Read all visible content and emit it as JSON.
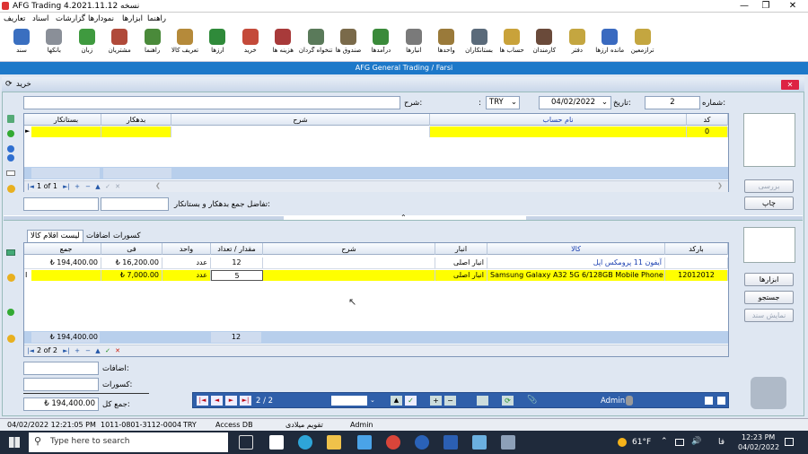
{
  "title_bar": {
    "title": "AFG Trading 4.2021.11.12 نسخه"
  },
  "menu": [
    "تعاریف",
    "اسناد",
    "گزارشات",
    "نمودارها",
    "ابزارها",
    "راهنما"
  ],
  "toolbar": [
    {
      "label": "سند",
      "icon": "document-icon",
      "color": "#3a6fc0"
    },
    {
      "label": "بانکها",
      "icon": "bank-icon",
      "color": "#8a8f98"
    },
    {
      "label": "زبان",
      "icon": "language-icon",
      "color": "#3f9a3f"
    },
    {
      "label": "مشتریان",
      "icon": "customers-icon",
      "color": "#b04a3a"
    },
    {
      "label": "راهنما",
      "icon": "help-icon",
      "color": "#4a8a3a"
    },
    {
      "label": "تعریف کالا",
      "icon": "product-icon",
      "color": "#b58a3a"
    },
    {
      "label": "ارزها",
      "icon": "currency-icon",
      "color": "#2f8a3a"
    },
    {
      "label": "خرید",
      "icon": "purchase-icon",
      "color": "#c44a3a"
    },
    {
      "label": "هزینه ها",
      "icon": "expenses-icon",
      "color": "#a83a3a"
    },
    {
      "label": "تنخواه گردان",
      "icon": "petty-cash-icon",
      "color": "#5a7a5a"
    },
    {
      "label": "صندوق ها",
      "icon": "cash-box-icon",
      "color": "#7a6a4a"
    },
    {
      "label": "درآمدها",
      "icon": "income-icon",
      "color": "#3a8a3a"
    },
    {
      "label": "انبارها",
      "icon": "warehouse-icon",
      "color": "#7a7a7a"
    },
    {
      "label": "واحدها",
      "icon": "units-icon",
      "color": "#9a7a3a"
    },
    {
      "label": "بستانکاران",
      "icon": "creditors-icon",
      "color": "#5a6a7a"
    },
    {
      "label": "حساب ها",
      "icon": "accounts-icon",
      "color": "#c9a23a"
    },
    {
      "label": "کارمندان",
      "icon": "employees-icon",
      "color": "#6a4a3a"
    },
    {
      "label": "دفتر",
      "icon": "ledger-icon",
      "color": "#c4a640"
    },
    {
      "label": "مانده ارزها",
      "icon": "currency-balance-icon",
      "color": "#3a6ac0"
    },
    {
      "label": "ترازمعین",
      "icon": "trial-balance-icon",
      "color": "#c4a640"
    }
  ],
  "subtitle": "AFG General Trading / Farsi",
  "form": {
    "title": "خرید",
    "number_label": "شماره:",
    "number_value": "2",
    "date_label": "تاریخ:",
    "date_value": "04/02/2022",
    "currency_value": "TRY",
    "description_label": "شرح:",
    "description_value": "",
    "colon": ":"
  },
  "accounts_grid": {
    "headers": {
      "code": "کد",
      "account_name": "نام حساب",
      "description": "شرح",
      "debit": "بدهکار",
      "credit": "بستانکار"
    },
    "row": {
      "code": "0"
    },
    "pager": "1 of 1"
  },
  "difference_label": "تفاضل جمع بدهکار و بستانکار:",
  "side_buttons_top": {
    "review": "بررسی",
    "print": "چاپ"
  },
  "tabs": {
    "items": "لیست اقلام کالا",
    "additions": "اضافات",
    "deductions": "کسورات"
  },
  "items_grid": {
    "headers": {
      "barcode": "بارکد",
      "product": "کالا",
      "warehouse": "انبار",
      "description": "شرح",
      "qty": "مقدار / تعداد",
      "unit": "واحد",
      "price": "فی",
      "total": "جمع"
    },
    "rows": [
      {
        "barcode": "",
        "product": "آیفون 11 پرومکس اپل",
        "warehouse": "انبار اصلی",
        "description": "",
        "qty": "12",
        "unit": "عدد",
        "price": "₺ 16,200.00",
        "total": "₺ 194,400.00"
      },
      {
        "barcode": "12012012",
        "product": "Samsung Galaxy A32 5G 6/128GB Mobile Phone",
        "warehouse": "انبار اصلی",
        "description": "",
        "qty": "5",
        "unit": "عدد",
        "price": "₺ 7,000.00",
        "total": ""
      }
    ],
    "sum_total": "₺ 194,400.00",
    "sum_qty": "12",
    "pager": "2 of 2"
  },
  "side_buttons_bottom": {
    "tools": "ابزارها",
    "search": "جستجو",
    "show_doc": "نمایش سند"
  },
  "totals": {
    "additions_label": "اضافات:",
    "deductions_label": "کسورات:",
    "grand_total_label": "جمع کل:",
    "grand_total_value": "₺ 194,400.00"
  },
  "bottom_nav": {
    "page": "2 / 2",
    "user": "Admin"
  },
  "status": {
    "datetime": "04/02/2022 12:21:05 PM",
    "code": "1011-0801-3112-0004",
    "currency": "TRY",
    "db": "Access DB",
    "calendar": "تقویم میلادی",
    "user": "Admin"
  },
  "taskbar": {
    "search_placeholder": "Type here to search",
    "weather": "61°F",
    "lang": "فا",
    "time": "12:23 PM",
    "date": "04/02/2022"
  }
}
